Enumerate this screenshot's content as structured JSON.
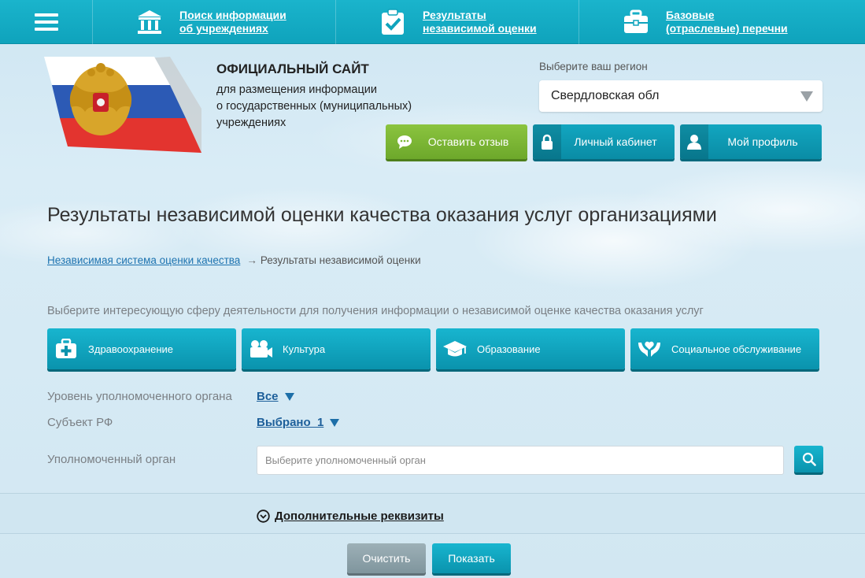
{
  "nav": {
    "items": [
      {
        "label": "Поиск информации\nоб учреждениях",
        "icon": "building-icon"
      },
      {
        "label": "Результаты\nнезависимой оценки",
        "icon": "clipboard-check-icon"
      },
      {
        "label": "Базовые\n(отраслевые) перечни",
        "icon": "briefcase-icon"
      }
    ]
  },
  "header": {
    "title": "ОФИЦИАЛЬНЫЙ САЙТ",
    "subtitle": "для размещения информации\nо государственных (муниципальных)\nучреждениях",
    "region_label": "Выберите ваш регион",
    "region_value": "Свердловская обл",
    "buttons": {
      "feedback": "Оставить отзыв",
      "cabinet": "Личный кабинет",
      "profile": "Мой профиль"
    }
  },
  "main": {
    "title": "Результаты независимой оценки качества оказания услуг организациями",
    "breadcrumb": {
      "link": "Независимая система оценки качества",
      "separator": "→",
      "current": "Результаты независимой оценки"
    },
    "prompt": "Выберите интересующую сферу деятельности для получения информации о независимой оценке качества оказания услуг",
    "categories": [
      {
        "label": "Здравоохранение",
        "icon": "medkit-icon"
      },
      {
        "label": "Культура",
        "icon": "movie-camera-icon"
      },
      {
        "label": "Образование",
        "icon": "graduation-cap-icon"
      },
      {
        "label": "Социальное обслуживание",
        "icon": "caring-hands-icon"
      }
    ],
    "filters": {
      "level_label": "Уровень уполномоченного органа",
      "level_value": "Все",
      "subject_label": "Субъект РФ",
      "subject_value": "Выбрано  1",
      "org_label": "Уполномоченный орган",
      "org_placeholder": "Выберите уполномоченный орган"
    },
    "extra_label": "Дополнительные реквизиты",
    "actions": {
      "clear": "Очистить",
      "show": "Показать"
    }
  },
  "colors": {
    "accent": "#0fa3bc",
    "green": "#7ab834",
    "link": "#1d73b0"
  }
}
